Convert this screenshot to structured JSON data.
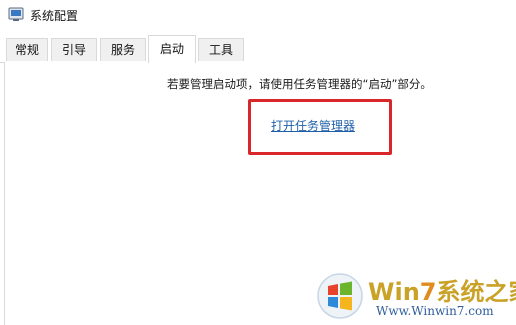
{
  "window": {
    "title": "系统配置",
    "icon": "msconfig-icon"
  },
  "tabs": [
    {
      "label": "常规",
      "active": false
    },
    {
      "label": "引导",
      "active": false
    },
    {
      "label": "服务",
      "active": false
    },
    {
      "label": "启动",
      "active": true
    },
    {
      "label": "工具",
      "active": false
    }
  ],
  "startup": {
    "info": "若要管理启动项，请使用任务管理器的“启动”部分。",
    "link": "打开任务管理器"
  },
  "annotation": {
    "highlight_color": "#d9262a"
  },
  "watermark": {
    "brand_prefix": "Win",
    "brand_seven": "7",
    "brand_suffix": "系统之家",
    "url": "Www.Winwin7.com"
  }
}
